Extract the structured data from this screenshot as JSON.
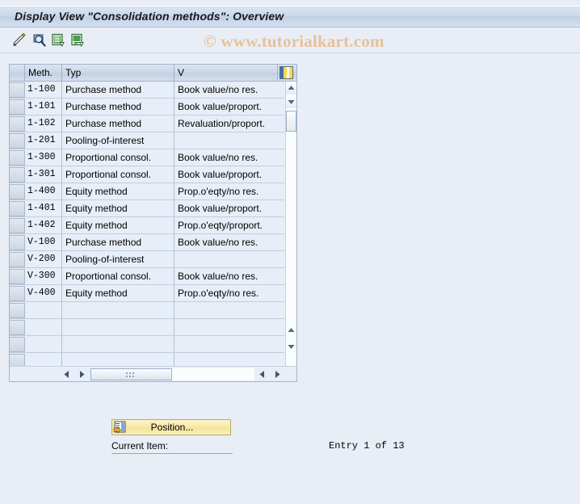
{
  "window": {
    "title": "Display View \"Consolidation methods\": Overview"
  },
  "watermark": {
    "text": "© www.tutorialkart.com"
  },
  "toolbar": {
    "items": [
      {
        "name": "change-entry-icon",
        "title": "Change"
      },
      {
        "name": "display-details-icon",
        "title": "Display"
      },
      {
        "name": "new-entries-icon",
        "title": "New Entries"
      },
      {
        "name": "copy-as-icon",
        "title": "Copy As"
      }
    ]
  },
  "table": {
    "columns": [
      {
        "key": "select",
        "label": ""
      },
      {
        "key": "meth",
        "label": "Meth."
      },
      {
        "key": "typ",
        "label": "Typ"
      },
      {
        "key": "v",
        "label": "V"
      }
    ],
    "config_icon": "column-configuration-icon",
    "rows": [
      {
        "meth": "1-100",
        "typ": "Purchase method",
        "v": "Book value/no res."
      },
      {
        "meth": "1-101",
        "typ": "Purchase method",
        "v": "Book value/proport."
      },
      {
        "meth": "1-102",
        "typ": "Purchase method",
        "v": "Revaluation/proport."
      },
      {
        "meth": "1-201",
        "typ": "Pooling-of-interest",
        "v": ""
      },
      {
        "meth": "1-300",
        "typ": "Proportional consol.",
        "v": "Book value/no res."
      },
      {
        "meth": "1-301",
        "typ": "Proportional consol.",
        "v": "Book value/proport."
      },
      {
        "meth": "1-400",
        "typ": "Equity method",
        "v": "Prop.o'eqty/no res."
      },
      {
        "meth": "1-401",
        "typ": "Equity method",
        "v": "Book value/proport."
      },
      {
        "meth": "1-402",
        "typ": "Equity method",
        "v": "Prop.o'eqty/proport."
      },
      {
        "meth": "V-100",
        "typ": "Purchase method",
        "v": "Book value/no res."
      },
      {
        "meth": "V-200",
        "typ": "Pooling-of-interest",
        "v": ""
      },
      {
        "meth": "V-300",
        "typ": "Proportional consol.",
        "v": "Book value/no res."
      },
      {
        "meth": "V-400",
        "typ": "Equity method",
        "v": "Prop.o'eqty/no res."
      },
      {
        "meth": "",
        "typ": "",
        "v": ""
      },
      {
        "meth": "",
        "typ": "",
        "v": ""
      },
      {
        "meth": "",
        "typ": "",
        "v": ""
      },
      {
        "meth": "",
        "typ": "",
        "v": ""
      }
    ]
  },
  "footer": {
    "position_button_label": "Position...",
    "current_item_label": "Current Item:",
    "current_item_value": "",
    "entry_info": "Entry 1 of 13"
  },
  "colors": {
    "background": "#e9eef6",
    "title_bar": "#cbd9ec",
    "table_row": "#e8eef7",
    "button_yellow": "#f8e9a8",
    "watermark": "#e8c199"
  }
}
